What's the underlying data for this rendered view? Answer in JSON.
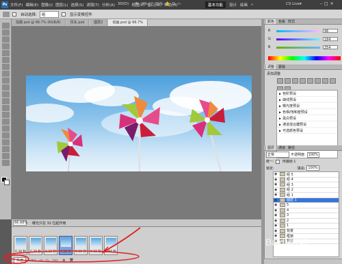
{
  "app": {
    "logo": "Ps",
    "menu": [
      "文件(F)",
      "编辑(E)",
      "图像(I)",
      "图层(L)",
      "选择(S)",
      "滤镜(T)",
      "分析(A)",
      "3D(D)",
      "视图(V)",
      "窗口(W)",
      "帮助(H)"
    ],
    "mini": [
      "Br",
      "Mb",
      "□",
      "70%",
      "✋",
      "Q",
      "▭"
    ],
    "workspaces": [
      "基本功能",
      "设计",
      "绘画",
      "»"
    ],
    "cslive": "CS Live▾",
    "window_buttons": [
      "–",
      "□",
      "×"
    ]
  },
  "options": {
    "autoselect_label": "自动选择:",
    "autoselect_value": "组",
    "transform_label": "显示变换控件"
  },
  "document": {
    "tabs": [
      "拍摄.psd @ 66.7% (RGB/8)",
      "风车.psd",
      "图层2",
      "动画.psd @ 66.7%"
    ],
    "zoom": "66.68%",
    "status": "曝光只在 32 位起作用"
  },
  "animation": {
    "frames": [
      {
        "label": "0.38 秒"
      },
      {
        "label": "0.38 秒"
      },
      {
        "label": "0.38 秒"
      },
      {
        "label": "0.38 秒"
      },
      {
        "label": "0.38 秒"
      },
      {
        "label": "0.38 秒"
      },
      {
        "label": "0.38 秒"
      }
    ],
    "selected": 3,
    "loop": "永远",
    "controls": [
      "◁◁",
      "◁",
      "▷",
      "▷▷",
      "⊕",
      "🗑"
    ]
  },
  "panels": {
    "color_tabs": [
      "颜色",
      "色板",
      "样式"
    ],
    "color": {
      "r": "96",
      "g": "184",
      "b": "254"
    },
    "adj_tabs": [
      "调整",
      "蒙版"
    ],
    "adj_title": "添加调整",
    "presets": [
      "色阶预设",
      "曲线预设",
      "曝光度预设",
      "色相/饱和度预设",
      "黑白预设",
      "通道混合器预设",
      "可选颜色预设"
    ],
    "layer_tabs": [
      "图层",
      "通道",
      "路径"
    ],
    "blend": "正常",
    "opacity_label": "不透明度:",
    "opacity": "100%",
    "lock_label": "锁定:",
    "fill_label": "填充:",
    "fill": "100%",
    "unify_label": "统一:",
    "propagate_label": "传播帧 1",
    "layers": [
      "组 5",
      "组 4",
      "组 3",
      "组 2",
      "组 1",
      "图层 1",
      "5",
      "4",
      "3",
      "2",
      "1",
      "背景",
      "框架",
      "背景"
    ]
  },
  "watermark": "Baidu经验",
  "colors": {
    "annotation": "#e02020",
    "panel_bg": "#d4d4d4",
    "selected": "#3875d7"
  }
}
